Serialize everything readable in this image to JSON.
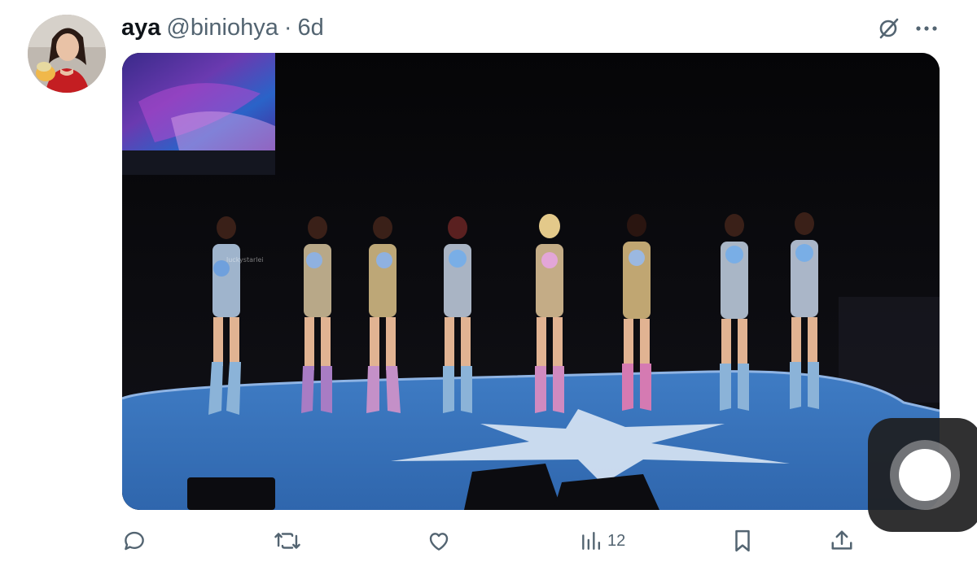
{
  "tweet": {
    "display_name": "aya",
    "handle": "@biniohya",
    "separator": "·",
    "time_ago": "6d",
    "media": {
      "description_icon": "concert-photo",
      "watermark_text": "luckystarlei"
    }
  },
  "header_icons": {
    "grok": "grok-icon",
    "more": "more-icon"
  },
  "actions": {
    "reply": {
      "icon": "reply-icon",
      "count": ""
    },
    "repost": {
      "icon": "repost-icon",
      "count": ""
    },
    "like": {
      "icon": "heart-icon",
      "count": ""
    },
    "views": {
      "icon": "views-icon",
      "count": "12"
    },
    "bookmark": {
      "icon": "bookmark-icon"
    },
    "share": {
      "icon": "share-icon"
    }
  },
  "overlay": {
    "assistive_touch": "assistive-touch-icon"
  },
  "colors": {
    "text_primary": "#0f1419",
    "text_secondary": "#536471",
    "stage_blue": "#3d78bd"
  }
}
